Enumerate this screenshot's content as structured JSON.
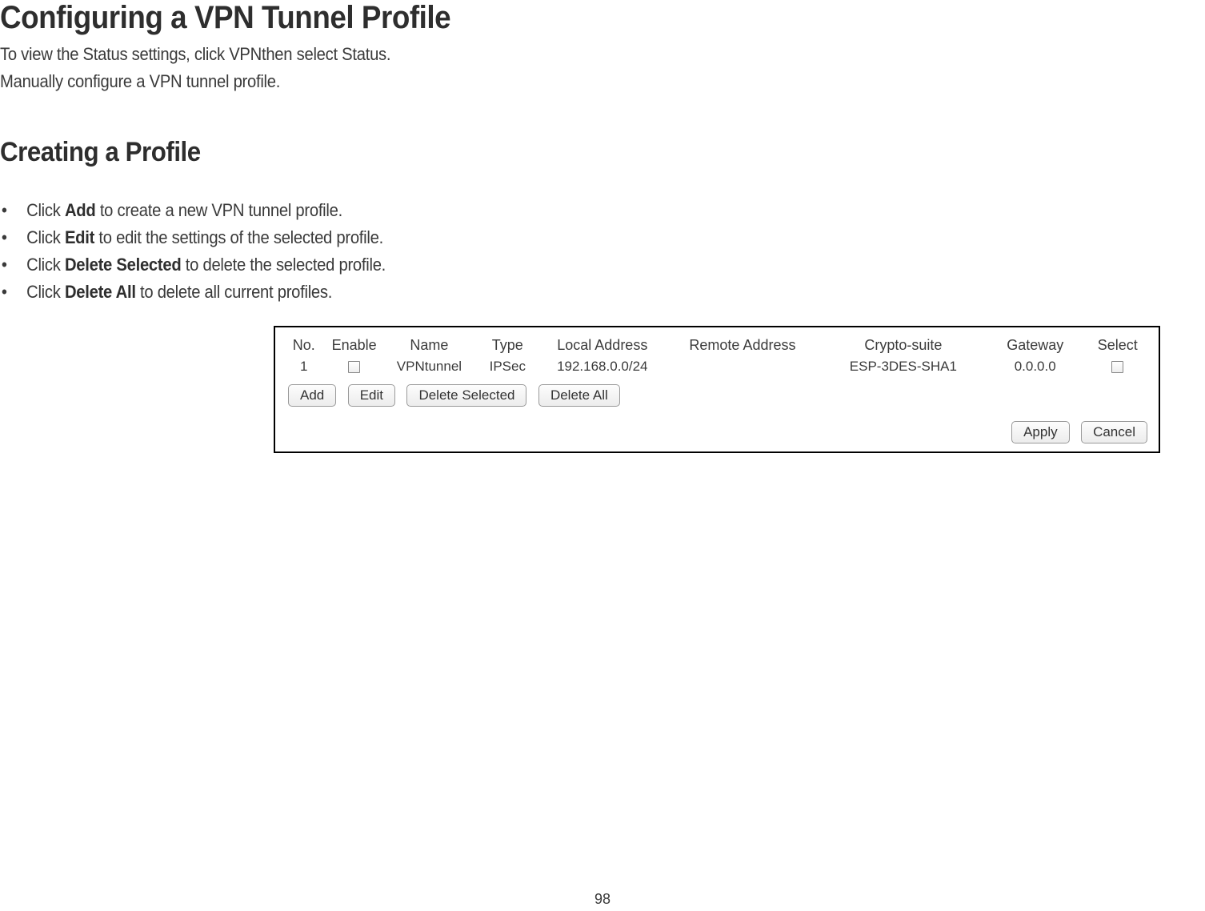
{
  "page": {
    "title": "Configuring a VPN Tunnel Profile",
    "intro1": "To view the Status settings, click VPNthen select Status.",
    "intro2": "Manually configure a VPN tunnel profile.",
    "subheading": "Creating a Profile",
    "number": "98"
  },
  "bullets": {
    "b1_pre": "Click ",
    "b1_bold": "Add",
    "b1_post": " to create a new VPN tunnel profile.",
    "b2_pre": "Click ",
    "b2_bold": "Edit",
    "b2_post": " to edit the settings of the selected profile.",
    "b3_pre": "Click ",
    "b3_bold": "Delete Selected",
    "b3_post": " to delete the selected profile.",
    "b4_pre": "Click ",
    "b4_bold": "Delete All",
    "b4_post": " to delete all current profiles."
  },
  "table": {
    "headers": {
      "no": "No.",
      "enable": "Enable",
      "name": "Name",
      "type": "Type",
      "local": "Local Address",
      "remote": "Remote Address",
      "crypto": "Crypto-suite",
      "gateway": "Gateway",
      "select": "Select"
    },
    "row1": {
      "no": "1",
      "name": "VPNtunnel",
      "type": "IPSec",
      "local": "192.168.0.0/24",
      "remote": "",
      "crypto": "ESP-3DES-SHA1",
      "gateway": "0.0.0.0"
    }
  },
  "buttons": {
    "add": "Add",
    "edit": "Edit",
    "delete_selected": "Delete Selected",
    "delete_all": "Delete All",
    "apply": "Apply",
    "cancel": "Cancel"
  }
}
